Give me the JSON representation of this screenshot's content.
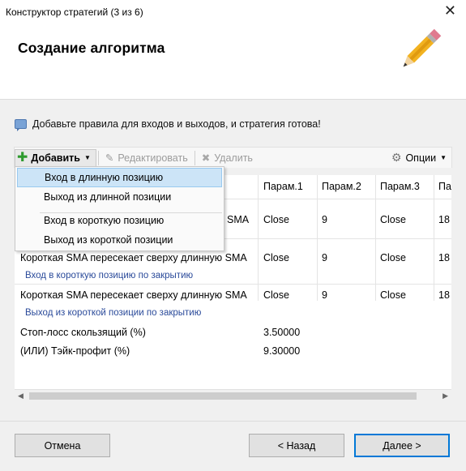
{
  "window": {
    "title": "Конструктор стратегий (3 из 6)",
    "close_glyph": "✕"
  },
  "header": {
    "title": "Создание алгоритма",
    "icon": "pencil-icon"
  },
  "intro": {
    "text": "Добавьте правила для входов и выходов, и стратегия готова!"
  },
  "toolbar": {
    "add_label": "Добавить",
    "edit_label": "Редактировать",
    "delete_label": "Удалить",
    "options_label": "Опции"
  },
  "grid": {
    "columns": [
      "Парам.1",
      "Парам.2",
      "Парам.3",
      "Па"
    ],
    "rows": [
      {
        "name": "SMA",
        "p1": "Close",
        "p2": "9",
        "p3": "Close",
        "p4": "18"
      },
      {
        "name": "Короткая SMA пересекает сверху длинную SMA",
        "p1": "Close",
        "p2": "9",
        "p3": "Close",
        "p4": "18"
      },
      {
        "name": "Короткая SMA пересекает сверху длинную SMA",
        "p1": "Close",
        "p2": "9",
        "p3": "Close",
        "p4": "18"
      }
    ],
    "groups": [
      "Вход в короткую позицию по закрытию",
      "Выход из короткой позиции по закрытию"
    ],
    "stop_loss": {
      "name": "Стоп-лосс скользящий (%)",
      "value": "3.50000"
    },
    "take_profit": {
      "name": "(ИЛИ) Тэйк-профит (%)",
      "value": "9.30000"
    }
  },
  "add_menu": {
    "items": [
      "Вход в длинную позицию",
      "Выход из длинной позиции",
      "Вход в короткую позицию",
      "Выход из короткой позиции"
    ],
    "selected_index": 0
  },
  "footer": {
    "cancel": "Отмена",
    "back": "< Назад",
    "next": "Далее >"
  },
  "colors": {
    "accent": "#0078d7",
    "group_text": "#2a4a9a",
    "menu_highlight": "#cce4f7"
  }
}
